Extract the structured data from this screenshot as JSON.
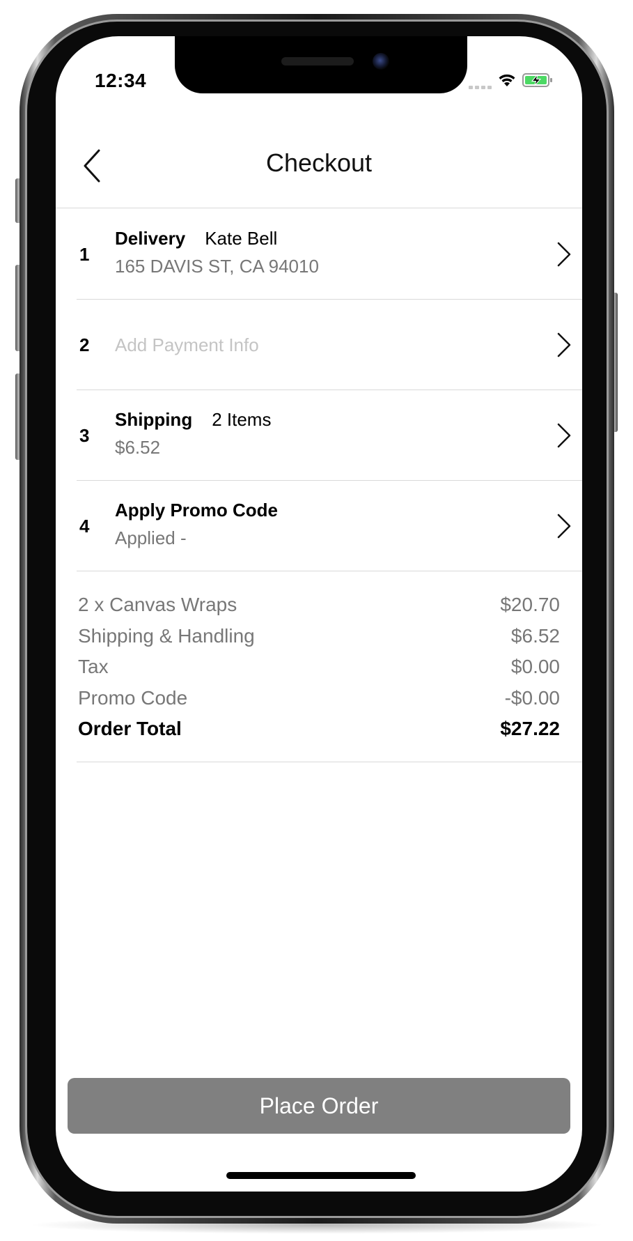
{
  "status_bar": {
    "time": "12:34",
    "icons": [
      "cellular-signal-icon",
      "wifi-icon",
      "battery-charging-icon"
    ],
    "battery_color": "#4cd964"
  },
  "nav": {
    "title": "Checkout",
    "back_icon": "chevron-left-icon"
  },
  "steps": [
    {
      "number": "1",
      "title": "Delivery",
      "title_detail": "Kate Bell",
      "subtitle": "165 DAVIS ST, CA 94010"
    },
    {
      "number": "2",
      "placeholder": "Add Payment Info"
    },
    {
      "number": "3",
      "title": "Shipping",
      "title_detail": "2 Items",
      "subtitle": "$6.52"
    },
    {
      "number": "4",
      "title": "Apply Promo Code",
      "title_detail": "",
      "subtitle": "Applied -"
    }
  ],
  "summary": {
    "rows": [
      {
        "label": "2 x Canvas Wraps",
        "value": "$20.70"
      },
      {
        "label": "Shipping & Handling",
        "value": "$6.52"
      },
      {
        "label": "Tax",
        "value": "$0.00"
      },
      {
        "label": "Promo Code",
        "value": "-$0.00"
      }
    ],
    "total": {
      "label": "Order Total",
      "value": "$27.22"
    }
  },
  "actions": {
    "place_order_label": "Place Order",
    "button_color": "#808080"
  },
  "colors": {
    "secondary_text": "#777777",
    "placeholder_text": "#c4c4c4",
    "divider": "#d9d9d9"
  }
}
